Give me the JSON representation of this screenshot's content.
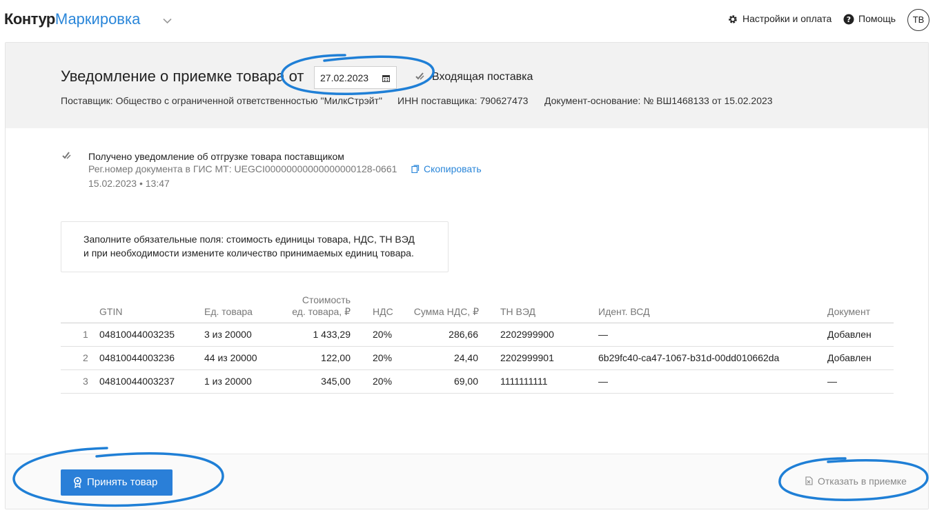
{
  "app": {
    "brand_main": "Контур",
    "brand_product": "Маркировка",
    "settings_label": "Настройки и оплата",
    "help_label": "Помощь",
    "avatar_initials": "ТВ"
  },
  "document": {
    "title": "Уведомление о приемке товара от",
    "date": "27.02.2023",
    "direction": "Входящая поставка",
    "supplier": "Поставщик: Общество с ограниченной ответственностью \"МилкСтрэйт\"",
    "supplier_inn": "ИНН поставщика: 790627473",
    "basis": "Документ-основание: № ВШ1468133 от 15.02.2023"
  },
  "notice": {
    "title": "Получено уведомление об отгрузке товара поставщиком",
    "reg_number": "Рег.номер документа в ГИС МТ: UEGCI00000000000000000128-0661",
    "copy_label": "Скопировать",
    "datetime": "15.02.2023 • 13:47"
  },
  "hint": {
    "line1": "Заполните обязательные поля: стоимость единицы товара, НДС, ТН ВЭД",
    "line2": "и при необходимости измените количество принимаемых единиц товара."
  },
  "table": {
    "headers": {
      "gtin": "GTIN",
      "unit": "Ед. товара",
      "price_line1": "Стоимость",
      "price_line2": "ед. товара, ₽",
      "vat": "НДС",
      "vat_sum": "Сумма НДС, ₽",
      "tnved": "ТН ВЭД",
      "vsd": "Идент. ВСД",
      "doc": "Документ"
    },
    "rows": [
      {
        "n": "1",
        "gtin": "04810044003235",
        "unit": "3 из 20000",
        "price": "1 433,29",
        "vat": "20%",
        "vat_sum": "286,66",
        "tnved": "2202999900",
        "vsd": "—",
        "doc": "Добавлен"
      },
      {
        "n": "2",
        "gtin": "04810044003236",
        "unit": "44 из 20000",
        "price": "122,00",
        "vat": "20%",
        "vat_sum": "24,40",
        "tnved": "2202999901",
        "vsd": "6b29fc40-ca47-1067-b31d-00dd010662da",
        "doc": "Добавлен"
      },
      {
        "n": "3",
        "gtin": "04810044003237",
        "unit": "1 из 20000",
        "price": "345,00",
        "vat": "20%",
        "vat_sum": "69,00",
        "tnved": "1111111111",
        "vsd": "—",
        "doc": "—"
      }
    ]
  },
  "footer": {
    "accept_label": "Принять товар",
    "reject_label": "Отказать в приемке"
  },
  "colors": {
    "accent": "#2a86d9",
    "button": "#2a7fd8",
    "annotation": "#1f7fd6"
  },
  "icons": [
    "chevron-down-icon",
    "gear-icon",
    "help-icon",
    "calendar-icon",
    "sign-icon",
    "copy-icon",
    "award-icon",
    "reject-icon"
  ]
}
